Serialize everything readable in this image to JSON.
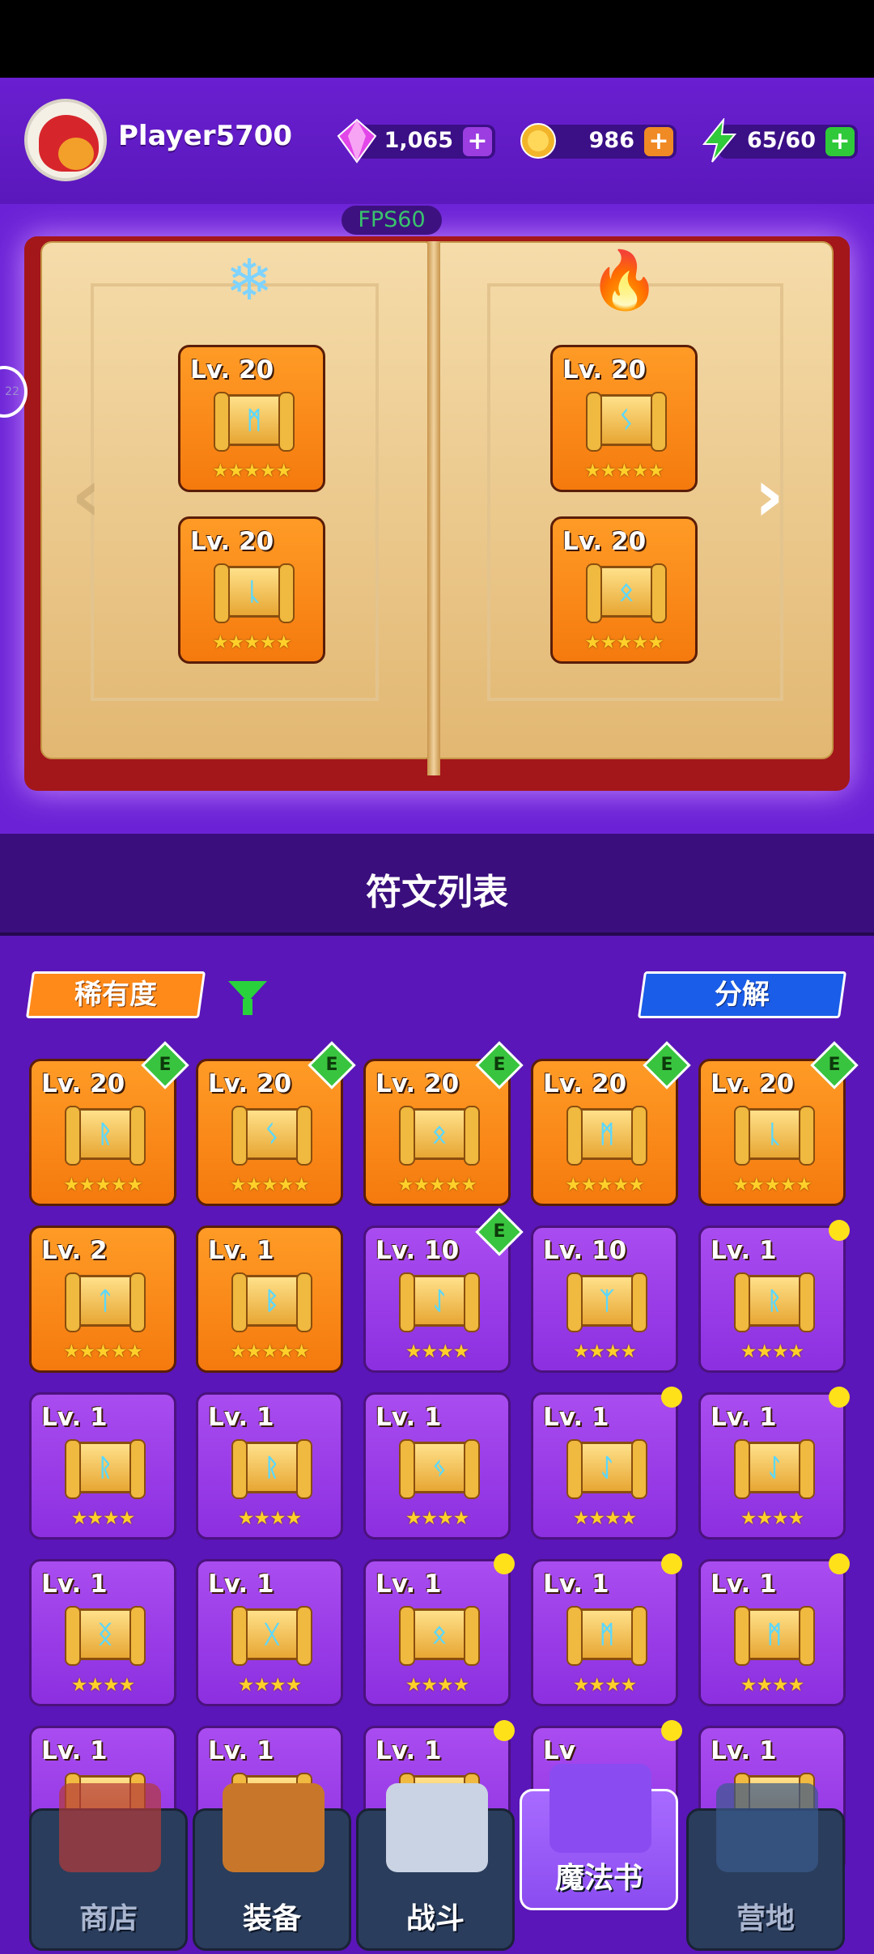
{
  "player": {
    "name": "Player5700"
  },
  "resources": [
    {
      "name": "gems",
      "value": "1,065",
      "plus": "+",
      "icon": "gem-icon",
      "color": "#e246e9"
    },
    {
      "name": "gold",
      "value": "986",
      "plus": "+",
      "icon": "coin-icon",
      "color": "#f2a02a"
    },
    {
      "name": "energy",
      "value": "65/60",
      "plus": "+",
      "icon": "lightning-icon",
      "color": "#2fc93a"
    }
  ],
  "fps": "FPS60",
  "side_button": "22",
  "spellbook": {
    "left_element": "❄",
    "right_element": "🔥",
    "slots": [
      {
        "page": "left",
        "level": "Lv. 20",
        "rune": "ᛗ",
        "stars": "★★★★★"
      },
      {
        "page": "left",
        "level": "Lv. 20",
        "rune": "ᚳ",
        "stars": "★★★★★"
      },
      {
        "page": "right",
        "level": "Lv. 20",
        "rune": "ᛊ",
        "stars": "★★★★★"
      },
      {
        "page": "right",
        "level": "Lv. 20",
        "rune": "ᛟ",
        "stars": "★★★★★"
      }
    ],
    "prev": "‹",
    "next": "›"
  },
  "rune_list": {
    "title": "符文列表",
    "rarity_label": "稀有度",
    "decompose_label": "分解",
    "equipped_label": "E",
    "cards": [
      {
        "level": "Lv. 20",
        "rune": "ᚱ",
        "stars": "★★★★★",
        "rarity": "orange",
        "equipped": true,
        "new": false
      },
      {
        "level": "Lv. 20",
        "rune": "ᛊ",
        "stars": "★★★★★",
        "rarity": "orange",
        "equipped": true,
        "new": false
      },
      {
        "level": "Lv. 20",
        "rune": "ᛟ",
        "stars": "★★★★★",
        "rarity": "orange",
        "equipped": true,
        "new": false
      },
      {
        "level": "Lv. 20",
        "rune": "ᛗ",
        "stars": "★★★★★",
        "rarity": "orange",
        "equipped": true,
        "new": false
      },
      {
        "level": "Lv. 20",
        "rune": "ᚳ",
        "stars": "★★★★★",
        "rarity": "orange",
        "equipped": true,
        "new": false
      },
      {
        "level": "Lv. 2",
        "rune": "ᛏ",
        "stars": "★★★★★",
        "rarity": "orange",
        "equipped": false,
        "new": false
      },
      {
        "level": "Lv. 1",
        "rune": "ᛒ",
        "stars": "★★★★★",
        "rarity": "orange",
        "equipped": false,
        "new": false
      },
      {
        "level": "Lv. 10",
        "rune": "ᛇ",
        "stars": "★★★★",
        "rarity": "purple",
        "equipped": true,
        "new": false
      },
      {
        "level": "Lv. 10",
        "rune": "ᛉ",
        "stars": "★★★★",
        "rarity": "purple",
        "equipped": false,
        "new": false
      },
      {
        "level": "Lv. 1",
        "rune": "ᚱ",
        "stars": "★★★★",
        "rarity": "purple",
        "equipped": false,
        "new": true
      },
      {
        "level": "Lv. 1",
        "rune": "ᚱ",
        "stars": "★★★★",
        "rarity": "purple",
        "equipped": false,
        "new": false
      },
      {
        "level": "Lv. 1",
        "rune": "ᚱ",
        "stars": "★★★★",
        "rarity": "purple",
        "equipped": false,
        "new": false
      },
      {
        "level": "Lv. 1",
        "rune": "ᛃ",
        "stars": "★★★★",
        "rarity": "purple",
        "equipped": false,
        "new": false
      },
      {
        "level": "Lv. 1",
        "rune": "ᛇ",
        "stars": "★★★★",
        "rarity": "purple",
        "equipped": false,
        "new": true
      },
      {
        "level": "Lv. 1",
        "rune": "ᛇ",
        "stars": "★★★★",
        "rarity": "purple",
        "equipped": false,
        "new": true
      },
      {
        "level": "Lv. 1",
        "rune": "ᛝ",
        "stars": "★★★★",
        "rarity": "purple",
        "equipped": false,
        "new": false
      },
      {
        "level": "Lv. 1",
        "rune": "ᚷ",
        "stars": "★★★★",
        "rarity": "purple",
        "equipped": false,
        "new": false
      },
      {
        "level": "Lv. 1",
        "rune": "ᛟ",
        "stars": "★★★★",
        "rarity": "purple",
        "equipped": false,
        "new": true
      },
      {
        "level": "Lv. 1",
        "rune": "ᛗ",
        "stars": "★★★★",
        "rarity": "purple",
        "equipped": false,
        "new": true
      },
      {
        "level": "Lv. 1",
        "rune": "ᛗ",
        "stars": "★★★★",
        "rarity": "purple",
        "equipped": false,
        "new": true
      },
      {
        "level": "Lv. 1",
        "rune": "",
        "stars": "",
        "rarity": "purple",
        "equipped": false,
        "new": false
      },
      {
        "level": "Lv. 1",
        "rune": "",
        "stars": "",
        "rarity": "purple",
        "equipped": false,
        "new": false
      },
      {
        "level": "Lv. 1",
        "rune": "",
        "stars": "",
        "rarity": "purple",
        "equipped": false,
        "new": true
      },
      {
        "level": "Lv",
        "rune": "",
        "stars": "",
        "rarity": "purple",
        "equipped": false,
        "new": true
      },
      {
        "level": "Lv. 1",
        "rune": "",
        "stars": "",
        "rarity": "purple",
        "equipped": false,
        "new": false
      }
    ]
  },
  "bottom_nav": [
    {
      "label": "商店",
      "icon": "shop-icon",
      "active": false,
      "dim": true
    },
    {
      "label": "装备",
      "icon": "backpack-icon",
      "active": false,
      "dim": false
    },
    {
      "label": "战斗",
      "icon": "crossed-swords-icon",
      "active": false,
      "dim": false
    },
    {
      "label": "魔法书",
      "icon": "spellbook-icon",
      "active": true,
      "dim": false
    },
    {
      "label": "营地",
      "icon": "shield-crown-icon",
      "active": false,
      "dim": true
    }
  ]
}
